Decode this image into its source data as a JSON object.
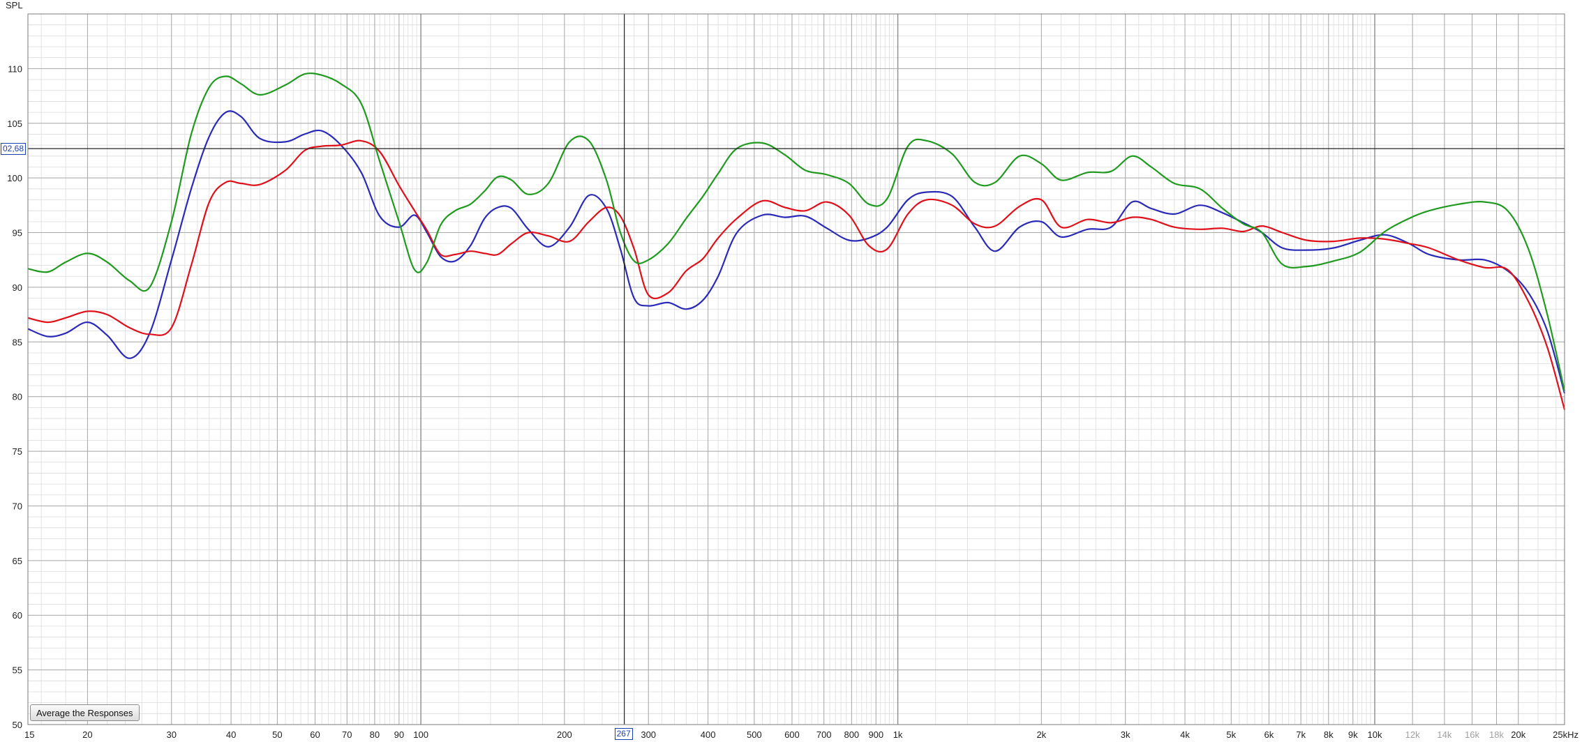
{
  "y_axis_label": "SPL",
  "cursor": {
    "spl_readout": "02,68",
    "freq_readout": "267"
  },
  "button": {
    "label": "Average the Responses"
  },
  "colors": {
    "series1": "#2a2ab8",
    "series2": "#e0101a",
    "series3": "#1f9a1f",
    "major_grid": "#a8a8a8",
    "minor_grid": "#dcdcdc",
    "cursor_line": "#222222"
  },
  "chart_data": {
    "type": "line",
    "xscale": "log",
    "xlim": [
      15,
      25000
    ],
    "ylim": [
      50,
      115
    ],
    "grid": true,
    "yticks": [
      {
        "v": 50,
        "label": "50"
      },
      {
        "v": 55,
        "label": "55"
      },
      {
        "v": 60,
        "label": "60"
      },
      {
        "v": 65,
        "label": "65"
      },
      {
        "v": 70,
        "label": "70"
      },
      {
        "v": 75,
        "label": "75"
      },
      {
        "v": 80,
        "label": "80"
      },
      {
        "v": 85,
        "label": "85"
      },
      {
        "v": 90,
        "label": "90"
      },
      {
        "v": 95,
        "label": "95"
      },
      {
        "v": 100,
        "label": "100"
      },
      {
        "v": 105,
        "label": "105"
      },
      {
        "v": 110,
        "label": "110"
      }
    ],
    "xticks": [
      {
        "v": 15,
        "label": "15"
      },
      {
        "v": 20,
        "label": "20"
      },
      {
        "v": 30,
        "label": "30"
      },
      {
        "v": 40,
        "label": "40"
      },
      {
        "v": 50,
        "label": "50"
      },
      {
        "v": 60,
        "label": "60"
      },
      {
        "v": 70,
        "label": "70"
      },
      {
        "v": 80,
        "label": "80"
      },
      {
        "v": 90,
        "label": "90"
      },
      {
        "v": 100,
        "label": "100"
      },
      {
        "v": 200,
        "label": "200"
      },
      {
        "v": 300,
        "label": "300"
      },
      {
        "v": 400,
        "label": "400"
      },
      {
        "v": 500,
        "label": "500"
      },
      {
        "v": 600,
        "label": "600"
      },
      {
        "v": 700,
        "label": "700"
      },
      {
        "v": 800,
        "label": "800"
      },
      {
        "v": 900,
        "label": "900"
      },
      {
        "v": 1000,
        "label": "1k"
      },
      {
        "v": 2000,
        "label": "2k"
      },
      {
        "v": 3000,
        "label": "3k"
      },
      {
        "v": 4000,
        "label": "4k"
      },
      {
        "v": 5000,
        "label": "5k"
      },
      {
        "v": 6000,
        "label": "6k"
      },
      {
        "v": 7000,
        "label": "7k"
      },
      {
        "v": 8000,
        "label": "8k"
      },
      {
        "v": 9000,
        "label": "9k"
      },
      {
        "v": 10000,
        "label": "10k"
      },
      {
        "v": 12000,
        "label": "12k",
        "muted": true
      },
      {
        "v": 14000,
        "label": "14k",
        "muted": true
      },
      {
        "v": 16000,
        "label": "16k",
        "muted": true
      },
      {
        "v": 18000,
        "label": "18k",
        "muted": true
      },
      {
        "v": 20000,
        "label": "20k"
      },
      {
        "v": 25000,
        "label": "25kHz"
      }
    ],
    "cursor": {
      "x": 267,
      "y": 102.68
    },
    "series": [
      {
        "color": "#2a2ab8",
        "x": [
          15,
          16.5,
          18,
          20,
          22,
          24.5,
          27,
          30,
          33,
          36,
          39,
          42,
          46,
          52,
          57,
          62,
          68,
          75,
          82,
          90,
          97,
          103,
          110,
          118,
          127,
          136,
          145,
          155,
          168,
          185,
          205,
          225,
          245,
          262,
          280,
          300,
          330,
          360,
          390,
          420,
          460,
          520,
          580,
          640,
          710,
          790,
          870,
          950,
          1050,
          1150,
          1300,
          1450,
          1600,
          1800,
          2000,
          2200,
          2500,
          2800,
          3100,
          3400,
          3800,
          4300,
          4800,
          5300,
          5800,
          6400,
          7200,
          8200,
          9300,
          10500,
          11800,
          13000,
          15000,
          17000,
          19000,
          21000,
          23000,
          25000
        ],
        "y": [
          86.2,
          85.5,
          85.8,
          86.8,
          85.6,
          83.5,
          85.8,
          92.5,
          99,
          103.8,
          106,
          105.6,
          103.6,
          103.3,
          104,
          104.3,
          103,
          100.5,
          96.5,
          95.5,
          96.6,
          95,
          92.8,
          92.4,
          93.8,
          96.3,
          97.3,
          97.2,
          95.3,
          93.7,
          95.5,
          98.4,
          97.2,
          93.5,
          89,
          88.3,
          88.6,
          88,
          88.8,
          91,
          95,
          96.6,
          96.4,
          96.5,
          95.4,
          94.3,
          94.5,
          95.5,
          98,
          98.7,
          98.3,
          95.5,
          93.3,
          95.5,
          96,
          94.6,
          95.3,
          95.5,
          97.8,
          97.2,
          96.7,
          97.5,
          96.8,
          95.9,
          95,
          93.6,
          93.4,
          93.6,
          94.3,
          94.8,
          94,
          93,
          92.5,
          92.5,
          91.5,
          89.5,
          86,
          80.3
        ]
      },
      {
        "color": "#e0101a",
        "x": [
          15,
          16.5,
          18,
          20,
          22,
          24.5,
          27,
          30,
          33,
          36,
          39,
          42,
          46,
          52,
          57,
          62,
          68,
          75,
          82,
          90,
          97,
          103,
          110,
          118,
          127,
          136,
          145,
          155,
          168,
          185,
          205,
          225,
          245,
          262,
          280,
          300,
          330,
          360,
          390,
          420,
          460,
          520,
          580,
          640,
          710,
          790,
          870,
          950,
          1050,
          1150,
          1300,
          1450,
          1600,
          1800,
          2000,
          2200,
          2500,
          2800,
          3100,
          3400,
          3800,
          4300,
          4800,
          5300,
          5800,
          6400,
          7200,
          8200,
          9300,
          10500,
          11800,
          13000,
          15000,
          17000,
          19000,
          21000,
          23000,
          25000
        ],
        "y": [
          87.2,
          86.8,
          87.2,
          87.8,
          87.5,
          86.3,
          85.7,
          86.3,
          92,
          97.8,
          99.6,
          99.5,
          99.4,
          100.7,
          102.5,
          102.9,
          103,
          103.4,
          102.4,
          99.3,
          97,
          95.2,
          93,
          93,
          93.3,
          93.1,
          93,
          94,
          95,
          94.7,
          94.2,
          96,
          97.3,
          96.5,
          93.5,
          89.3,
          89.5,
          91.5,
          92.6,
          94.5,
          96.3,
          97.9,
          97.3,
          97,
          97.8,
          96.6,
          93.8,
          93.5,
          96.7,
          98,
          97.5,
          95.8,
          95.6,
          97.4,
          98,
          95.5,
          96.2,
          95.9,
          96.4,
          96.2,
          95.5,
          95.3,
          95.4,
          95.1,
          95.6,
          95,
          94.3,
          94.2,
          94.5,
          94.4,
          94,
          93.6,
          92.5,
          91.8,
          91.6,
          88.7,
          84.5,
          78.8
        ]
      },
      {
        "color": "#1f9a1f",
        "x": [
          15,
          16.5,
          18,
          20,
          22,
          24.5,
          27,
          30,
          33,
          36,
          39,
          42,
          46,
          52,
          57,
          62,
          68,
          75,
          82,
          90,
          97,
          103,
          110,
          118,
          127,
          136,
          145,
          155,
          168,
          185,
          205,
          225,
          245,
          262,
          280,
          300,
          330,
          360,
          390,
          420,
          460,
          520,
          580,
          640,
          710,
          790,
          870,
          950,
          1050,
          1150,
          1300,
          1450,
          1600,
          1800,
          2000,
          2200,
          2500,
          2800,
          3100,
          3400,
          3800,
          4300,
          4800,
          5300,
          5800,
          6400,
          7200,
          8200,
          9300,
          10500,
          11800,
          13000,
          15000,
          17000,
          19000,
          21000,
          23000,
          25000
        ],
        "y": [
          91.7,
          91.4,
          92.3,
          93.1,
          92.3,
          90.6,
          90,
          96,
          104,
          108.3,
          109.3,
          108.6,
          107.6,
          108.5,
          109.5,
          109.4,
          108.6,
          106.8,
          101.5,
          96,
          91.6,
          92.3,
          95.7,
          97,
          97.6,
          98.8,
          100.1,
          99.8,
          98.5,
          99.5,
          103.3,
          103.4,
          99.8,
          95,
          92.4,
          92.5,
          94,
          96.3,
          98.3,
          100.4,
          102.7,
          103.2,
          102.1,
          100.7,
          100.3,
          99.5,
          97.6,
          98.1,
          102.9,
          103.4,
          102.2,
          99.6,
          99.6,
          102,
          101.3,
          99.8,
          100.5,
          100.6,
          102,
          101,
          99.5,
          99,
          97.2,
          95.8,
          95,
          92.1,
          91.9,
          92.4,
          93.2,
          95.1,
          96.3,
          97,
          97.6,
          97.8,
          97,
          93.5,
          87.5,
          80.5
        ]
      }
    ]
  }
}
